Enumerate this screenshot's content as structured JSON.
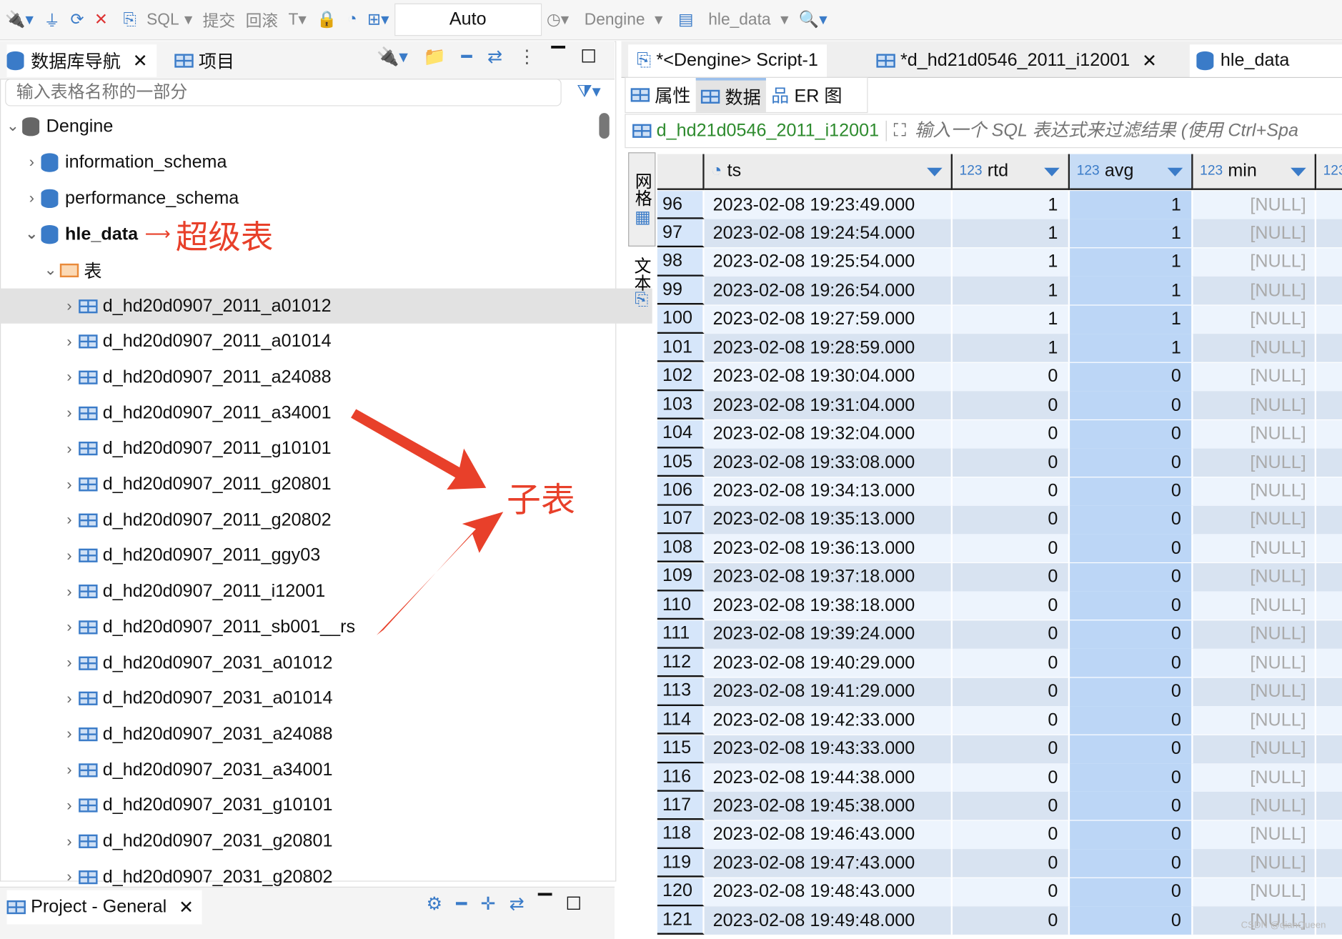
{
  "toolbar": {
    "sql": "SQL",
    "commit": "提交",
    "rollback": "回滚",
    "mode": "Auto",
    "datasource": "Dengine",
    "schema": "hle_data"
  },
  "nav": {
    "tab1": "数据库导航",
    "tab2": "项目",
    "search_placeholder": "输入表格名称的一部分",
    "root": "Dengine",
    "schemas": [
      "information_schema",
      "performance_schema",
      "hle_data"
    ],
    "folder": "表",
    "tables": [
      "d_hd20d0907_2011_a01012",
      "d_hd20d0907_2011_a01014",
      "d_hd20d0907_2011_a24088",
      "d_hd20d0907_2011_a34001",
      "d_hd20d0907_2011_g10101",
      "d_hd20d0907_2011_g20801",
      "d_hd20d0907_2011_g20802",
      "d_hd20d0907_2011_ggy03",
      "d_hd20d0907_2011_i12001",
      "d_hd20d0907_2011_sb001__rs",
      "d_hd20d0907_2031_a01012",
      "d_hd20d0907_2031_a01014",
      "d_hd20d0907_2031_a24088",
      "d_hd20d0907_2031_a34001",
      "d_hd20d0907_2031_g10101",
      "d_hd20d0907_2031_g20801",
      "d_hd20d0907_2031_g20802"
    ]
  },
  "annotations": {
    "super_table": "超级表",
    "child_table": "子表"
  },
  "project": {
    "tab": "Project - General"
  },
  "editor": {
    "tabs": [
      "*<Dengine> Script-1",
      "*d_hd21d0546_2011_i12001",
      "hle_data"
    ],
    "subtabs": [
      "属性",
      "数据",
      "ER 图"
    ],
    "table_name": "d_hd21d0546_2011_i12001",
    "filter_placeholder": "输入一个 SQL 表达式来过滤结果 (使用 Ctrl+Spa",
    "side_tabs": [
      "网格",
      "文本"
    ],
    "columns": [
      {
        "type": "",
        "name": "ts"
      },
      {
        "type": "123",
        "name": "rtd"
      },
      {
        "type": "123",
        "name": "avg"
      },
      {
        "type": "123",
        "name": "min"
      },
      {
        "type": "123",
        "name": ""
      }
    ],
    "rows": [
      [
        "96",
        "2023-02-08 19:23:49.000",
        "1",
        "1",
        "[NULL]"
      ],
      [
        "97",
        "2023-02-08 19:24:54.000",
        "1",
        "1",
        "[NULL]"
      ],
      [
        "98",
        "2023-02-08 19:25:54.000",
        "1",
        "1",
        "[NULL]"
      ],
      [
        "99",
        "2023-02-08 19:26:54.000",
        "1",
        "1",
        "[NULL]"
      ],
      [
        "100",
        "2023-02-08 19:27:59.000",
        "1",
        "1",
        "[NULL]"
      ],
      [
        "101",
        "2023-02-08 19:28:59.000",
        "1",
        "1",
        "[NULL]"
      ],
      [
        "102",
        "2023-02-08 19:30:04.000",
        "0",
        "0",
        "[NULL]"
      ],
      [
        "103",
        "2023-02-08 19:31:04.000",
        "0",
        "0",
        "[NULL]"
      ],
      [
        "104",
        "2023-02-08 19:32:04.000",
        "0",
        "0",
        "[NULL]"
      ],
      [
        "105",
        "2023-02-08 19:33:08.000",
        "0",
        "0",
        "[NULL]"
      ],
      [
        "106",
        "2023-02-08 19:34:13.000",
        "0",
        "0",
        "[NULL]"
      ],
      [
        "107",
        "2023-02-08 19:35:13.000",
        "0",
        "0",
        "[NULL]"
      ],
      [
        "108",
        "2023-02-08 19:36:13.000",
        "0",
        "0",
        "[NULL]"
      ],
      [
        "109",
        "2023-02-08 19:37:18.000",
        "0",
        "0",
        "[NULL]"
      ],
      [
        "110",
        "2023-02-08 19:38:18.000",
        "0",
        "0",
        "[NULL]"
      ],
      [
        "111",
        "2023-02-08 19:39:24.000",
        "0",
        "0",
        "[NULL]"
      ],
      [
        "112",
        "2023-02-08 19:40:29.000",
        "0",
        "0",
        "[NULL]"
      ],
      [
        "113",
        "2023-02-08 19:41:29.000",
        "0",
        "0",
        "[NULL]"
      ],
      [
        "114",
        "2023-02-08 19:42:33.000",
        "0",
        "0",
        "[NULL]"
      ],
      [
        "115",
        "2023-02-08 19:43:33.000",
        "0",
        "0",
        "[NULL]"
      ],
      [
        "116",
        "2023-02-08 19:44:38.000",
        "0",
        "0",
        "[NULL]"
      ],
      [
        "117",
        "2023-02-08 19:45:38.000",
        "0",
        "0",
        "[NULL]"
      ],
      [
        "118",
        "2023-02-08 19:46:43.000",
        "0",
        "0",
        "[NULL]"
      ],
      [
        "119",
        "2023-02-08 19:47:43.000",
        "0",
        "0",
        "[NULL]"
      ],
      [
        "120",
        "2023-02-08 19:48:43.000",
        "0",
        "0",
        "[NULL]"
      ],
      [
        "121",
        "2023-02-08 19:49:48.000",
        "0",
        "0",
        "[NULL]"
      ]
    ]
  },
  "watermark": "CSDN @qianQueen"
}
